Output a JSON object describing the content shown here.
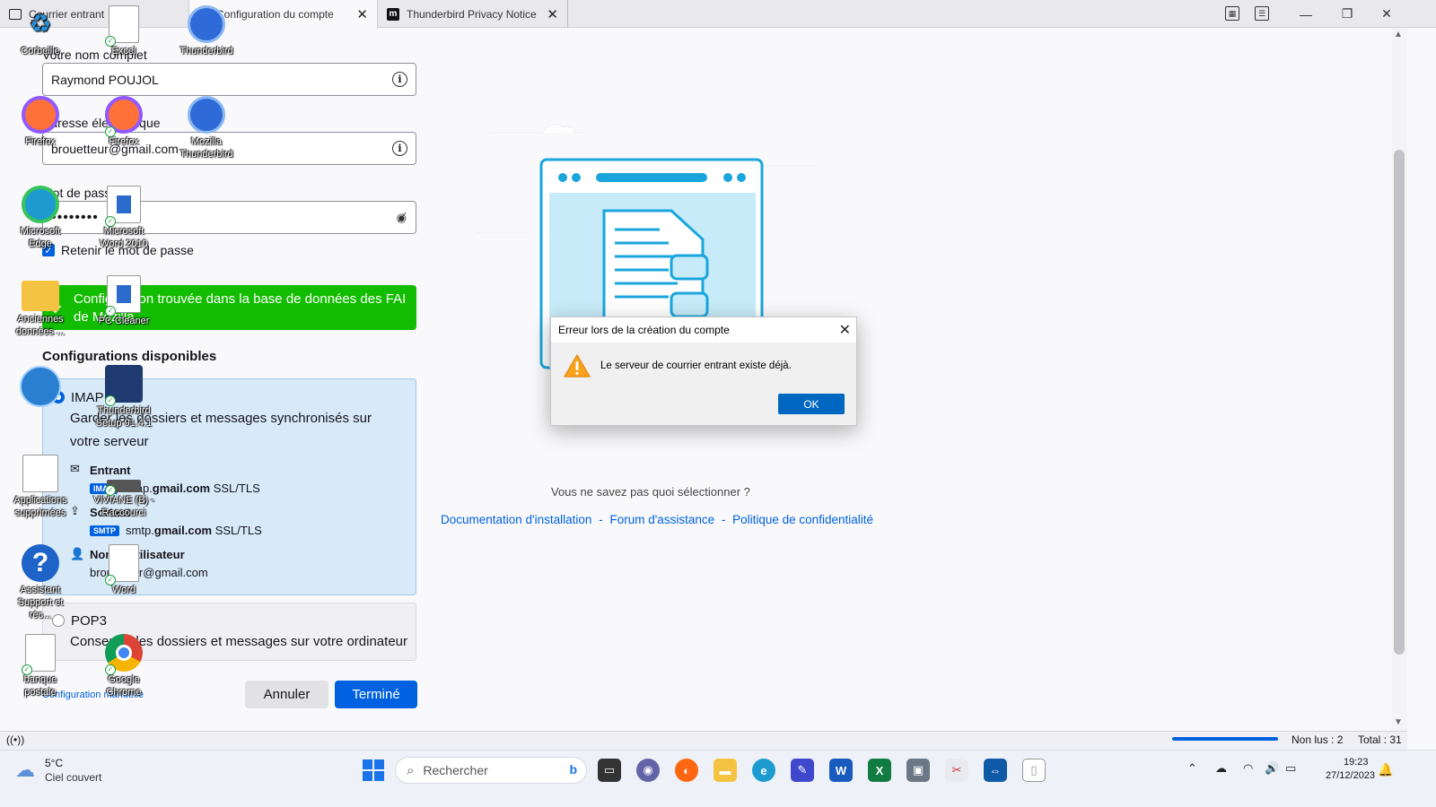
{
  "tabs": [
    {
      "label": "Courrier entrant"
    },
    {
      "label": "Configuration du compte"
    },
    {
      "label": "Thunderbird Privacy Notice"
    }
  ],
  "form": {
    "name_label": "Votre nom complet",
    "name_value": "Raymond POUJOL",
    "email_label": "Adresse électronique",
    "email_value": "brouetteur@gmail.com",
    "password_label": "Mot de passe",
    "password_value": "••••••••",
    "remember_label": "Retenir le mot de passe",
    "banner_text": "Configuration trouvée dans la base de données des FAI de Mozilla.",
    "configs_title": "Configurations disponibles",
    "imap": {
      "label": "IMAP",
      "description": "Garder les dossiers et messages synchronisés sur votre serveur",
      "incoming_label": "Entrant",
      "incoming_badge": "IMAP",
      "incoming_host_pre": "imap.",
      "incoming_host_bold": "gmail.com",
      "incoming_security": "SSL/TLS",
      "outgoing_label": "Sortant",
      "outgoing_badge": "SMTP",
      "outgoing_host_pre": "smtp.",
      "outgoing_host_bold": "gmail.com",
      "outgoing_security": "SSL/TLS",
      "username_label": "Nom d'utilisateur",
      "username_value": "brouetteur@gmail.com"
    },
    "pop3": {
      "label": "POP3",
      "description": "Conserver les dossiers et messages sur votre ordinateur"
    },
    "manual_link": "Configuration manuelle",
    "cancel_label": "Annuler",
    "done_label": "Terminé"
  },
  "right": {
    "help_text": "Vous ne savez pas quoi sélectionner ?",
    "link_docs": "Documentation d'installation",
    "link_forum": "Forum d'assistance",
    "link_privacy": "Politique de confidentialité",
    "separator": "-"
  },
  "dialog": {
    "title": "Erreur lors de la création du compte",
    "message": "Le serveur de courrier entrant existe déjà.",
    "ok_label": "OK"
  },
  "statusbar": {
    "unread": "Non lus : 2",
    "total": "Total : 31"
  },
  "taskbar": {
    "weather_temp": "5°C",
    "weather_desc": "Ciel couvert",
    "search_placeholder": "Rechercher",
    "time": "19:23",
    "date": "27/12/2023"
  },
  "desktop_icons": [
    {
      "label": "Corbeille"
    },
    {
      "label": "Excel"
    },
    {
      "label": "Thunderbird"
    },
    {
      "label": "Firefox"
    },
    {
      "label": "Firefox"
    },
    {
      "label": "Mozilla Thunderbird"
    },
    {
      "label": "Microsoft Edge"
    },
    {
      "label": "Microsoft Word 2010"
    },
    {
      "label": "Anciennes données ..."
    },
    {
      "label": "PC Cleaner"
    },
    {
      "label": "Thunderbird Setup 91.4.1"
    },
    {
      "label": "Applications supprimées"
    },
    {
      "label": "VIVIANE (B) - Raccourci"
    },
    {
      "label": "Assistant Support et réc..."
    },
    {
      "label": "Word"
    },
    {
      "label": "banque postale"
    },
    {
      "label": "Google Chrome"
    }
  ],
  "colors": {
    "accent": "#0061e0",
    "banner_green": "#12bc00",
    "imap_bg": "#d8e9f8",
    "warning": "#f7a21b"
  }
}
